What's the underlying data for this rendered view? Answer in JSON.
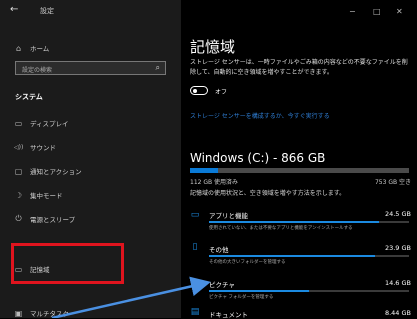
{
  "window": {
    "back_icon": "back-arrow-icon",
    "title": "設定",
    "minimize": "−",
    "maximize": "□",
    "close": "✕"
  },
  "sidebar": {
    "home": {
      "icon": "home-icon",
      "glyph": "⌂",
      "label": "ホーム"
    },
    "search": {
      "placeholder": "設定の検索",
      "icon": "search-icon",
      "glyph": "⌕"
    },
    "section_title": "システム",
    "items": [
      {
        "icon": "display-icon",
        "glyph": "▭",
        "label": "ディスプレイ"
      },
      {
        "icon": "sound-icon",
        "glyph": "◁))",
        "label": "サウンド"
      },
      {
        "icon": "notifications-icon",
        "glyph": "▢",
        "label": "通知とアクション"
      },
      {
        "icon": "focus-assist-icon",
        "glyph": "☽",
        "label": "集中モード"
      },
      {
        "icon": "power-sleep-icon",
        "glyph": "⏻",
        "label": "電源とスリープ"
      },
      {
        "icon": "storage-icon",
        "glyph": "▭",
        "label": "記憶域"
      },
      {
        "icon": "multitasking-icon",
        "glyph": "▣",
        "label": "マルチタスク"
      }
    ]
  },
  "main": {
    "title": "記憶域",
    "description": "ストレージ センサーは、一時ファイルやごみ箱の内容などの不要なファイルを削除して、自動的に空き領域を増やすことができます。",
    "toggle_label": "オフ",
    "toggle_state": "off",
    "sense_link": "ストレージ センサーを構成するか、今すぐ実行する",
    "drive": {
      "name": "Windows (C:) - 866 GB",
      "used": "112 GB 使用済み",
      "free": "753 GB 空き",
      "used_fraction": 0.13,
      "hint": "記憶域の使用状況と、空き領域を増やす方法を示します。"
    },
    "categories": [
      {
        "icon": "apps-icon",
        "glyph": "▭",
        "name": "アプリと機能",
        "size": "24.5 GB",
        "fraction": 0.85,
        "sub": "使用されていない、または不要なアプリと機能をアンインストールする"
      },
      {
        "icon": "other-icon",
        "glyph": "▯",
        "name": "その他",
        "size": "23.9 GB",
        "fraction": 0.83,
        "sub": "その他の大きいフォルダーを管理する"
      },
      {
        "icon": "pictures-icon",
        "glyph": "▨",
        "name": "ピクチャ",
        "size": "14.6 GB",
        "fraction": 0.5,
        "sub": "ピクチャ フォルダーを管理する"
      },
      {
        "icon": "documents-icon",
        "glyph": "▤",
        "name": "ドキュメント",
        "size": "8.44 GB",
        "fraction": 0.3,
        "sub": ""
      }
    ]
  },
  "colors": {
    "accent": "#0a7ad6",
    "highlight": "#e0141e",
    "annotation_arrow": "#4a90e2"
  }
}
